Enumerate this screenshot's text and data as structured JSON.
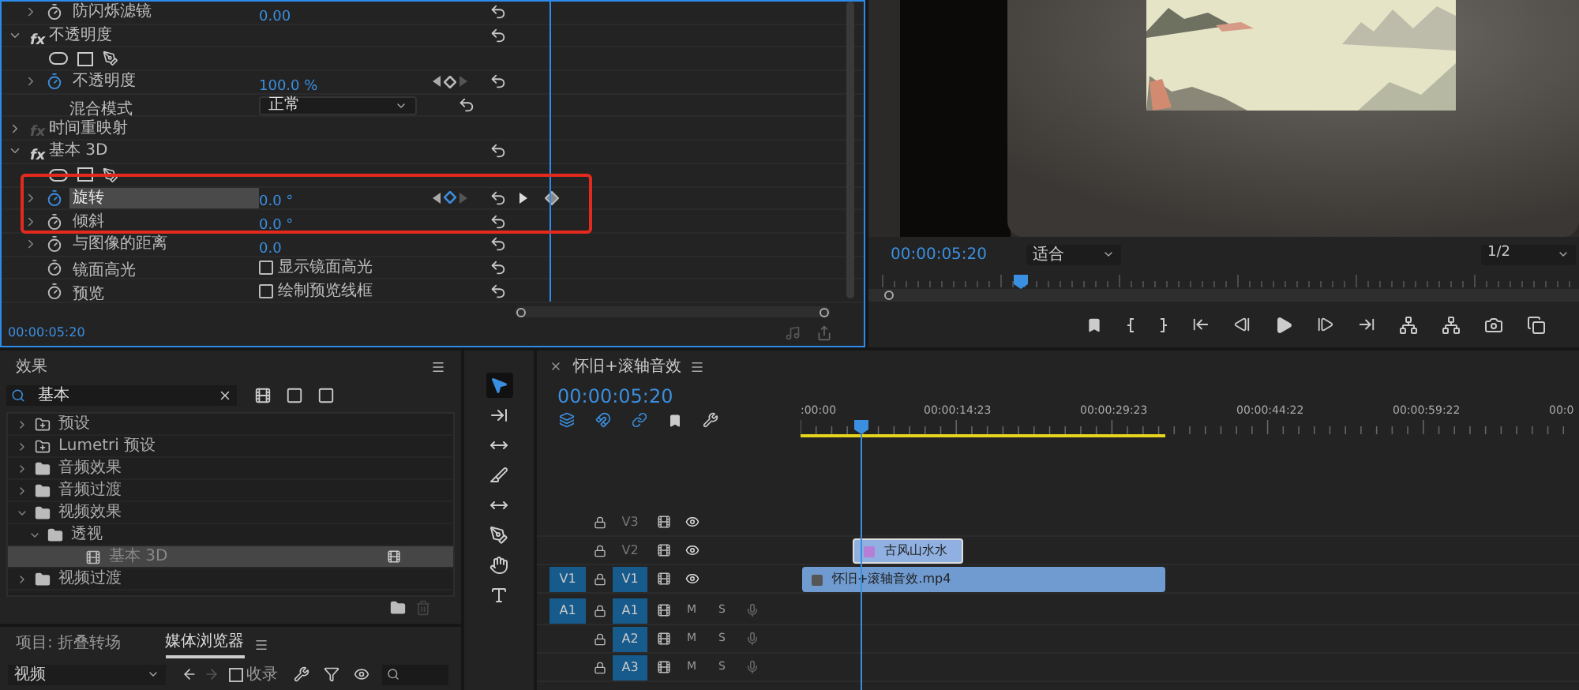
{
  "effect_controls": {
    "rows": [
      {
        "kind": "property",
        "label": "防闪烁滤镜",
        "value": "0.00",
        "animating": false,
        "selected": false
      },
      {
        "kind": "effect",
        "badge": "fx",
        "label": "不透明度",
        "expanded": true,
        "enabled": true
      },
      {
        "kind": "masks"
      },
      {
        "kind": "property",
        "label": "不透明度",
        "value": "100.0 %",
        "animating": true,
        "selected": false,
        "on_keyframe": false
      },
      {
        "kind": "dropdown",
        "label": "混合模式",
        "value": "正常"
      },
      {
        "kind": "effect",
        "badge": "fx",
        "label": "时间重映射",
        "expanded": false,
        "enabled": false
      },
      {
        "kind": "effect",
        "badge": "fx",
        "label": "基本 3D",
        "expanded": true,
        "enabled": true
      },
      {
        "kind": "masks"
      },
      {
        "kind": "property",
        "label": "旋转",
        "value": "0.0 °",
        "animating": true,
        "selected": true,
        "on_keyframe": true
      },
      {
        "kind": "property",
        "label": "倾斜",
        "value": "0.0 °",
        "animating": false,
        "selected": false
      },
      {
        "kind": "property",
        "label": "与图像的距离",
        "value": "0.0",
        "animating": false,
        "selected": false
      },
      {
        "kind": "checkbox",
        "label": "镜面高光",
        "option": "显示镜面高光",
        "checked": false
      },
      {
        "kind": "checkbox",
        "label": "预览",
        "option": "绘制预览线框",
        "checked": false
      }
    ],
    "timecode": "00:00:05:20"
  },
  "program_monitor": {
    "timecode": "00:00:05:20",
    "zoom": "适合",
    "resolution": "1/2"
  },
  "effects_panel": {
    "title": "效果",
    "search": "基本",
    "tree": [
      {
        "label": "预设",
        "kind": "preset_bin",
        "expanded": false,
        "selected": false
      },
      {
        "label": "Lumetri 预设",
        "kind": "preset_bin",
        "expanded": false,
        "selected": false
      },
      {
        "label": "音频效果",
        "kind": "folder",
        "expanded": false,
        "selected": false
      },
      {
        "label": "音频过渡",
        "kind": "folder",
        "expanded": false,
        "selected": false
      },
      {
        "label": "视频效果",
        "kind": "folder",
        "expanded": true,
        "selected": false,
        "children": [
          {
            "label": "透视",
            "kind": "folder",
            "expanded": true,
            "selected": false,
            "children": [
              {
                "label": "基本 3D",
                "kind": "effect",
                "selected": true
              }
            ]
          }
        ]
      },
      {
        "label": "视频过渡",
        "kind": "folder",
        "expanded": false,
        "selected": false
      }
    ]
  },
  "bottom_tabs": [
    {
      "label": "项目: 折叠转场",
      "selected": false
    },
    {
      "label": "媒体浏览器",
      "selected": true
    }
  ],
  "media_browser": {
    "view": "视频",
    "ingest_label": "收录",
    "ingest_checked": false
  },
  "tools": [
    {
      "kind": "selection",
      "selected": true
    },
    {
      "kind": "track_select",
      "selected": false
    },
    {
      "kind": "ripple",
      "selected": false
    },
    {
      "kind": "razor",
      "selected": false
    },
    {
      "kind": "slip",
      "selected": false
    },
    {
      "kind": "pen",
      "selected": false
    },
    {
      "kind": "hand",
      "selected": false
    },
    {
      "kind": "type",
      "selected": false
    }
  ],
  "timeline": {
    "sequence": "怀旧+滚轴音效",
    "timecode": "00:00:05:20",
    "ruler": [
      ":00:00",
      "00:00:14:23",
      "00:00:29:23",
      "00:00:44:22",
      "00:00:59:22",
      "00:0"
    ],
    "tracks": [
      {
        "kind": "video",
        "name": "V3",
        "targeted": false
      },
      {
        "kind": "video",
        "name": "V2",
        "targeted": false
      },
      {
        "kind": "video",
        "name": "V1",
        "source": "V1",
        "targeted": true
      },
      {
        "kind": "audio",
        "name": "A1",
        "source": "A1",
        "targeted": true,
        "mute": "M",
        "solo": "S"
      },
      {
        "kind": "audio",
        "name": "A2",
        "targeted": true,
        "mute": "M",
        "solo": "S"
      },
      {
        "kind": "audio",
        "name": "A3",
        "targeted": true,
        "mute": "M",
        "solo": "S"
      }
    ],
    "clips": [
      {
        "kind": "graphic",
        "name": "古风山水水"
      },
      {
        "kind": "video",
        "name": "怀旧+滚轴音效.mp4"
      }
    ]
  }
}
